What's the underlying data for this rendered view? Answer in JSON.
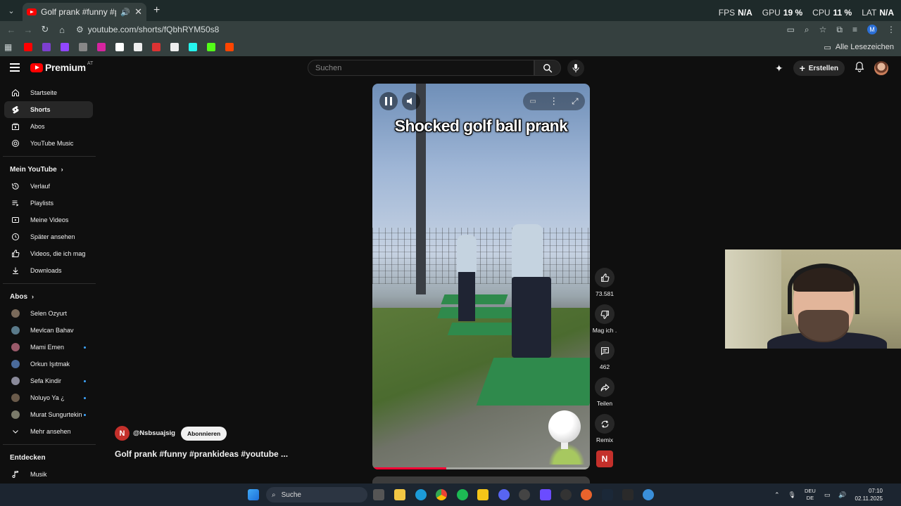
{
  "browser": {
    "tab_title": "Golf prank #funny #prankic",
    "url": "youtube.com/shorts/fQbhRYM50s8",
    "all_bookmarks": "Alle Lesezeichen",
    "profile_initial": "M"
  },
  "osd": {
    "fps_label": "FPS",
    "fps_value": "N/A",
    "gpu_label": "GPU",
    "gpu_value": "19 %",
    "cpu_label": "CPU",
    "cpu_value": "11 %",
    "lat_label": "LAT",
    "lat_value": "N/A"
  },
  "header": {
    "logo_text": "Premium",
    "region": "AT",
    "search_placeholder": "Suchen",
    "create_label": "Erstellen"
  },
  "sidebar": {
    "main": [
      {
        "label": "Startseite",
        "icon": "home-icon"
      },
      {
        "label": "Shorts",
        "icon": "shorts-icon"
      },
      {
        "label": "Abos",
        "icon": "subscriptions-icon"
      },
      {
        "label": "YouTube Music",
        "icon": "music-icon"
      }
    ],
    "you_title": "Mein YouTube",
    "you": [
      {
        "label": "Verlauf",
        "icon": "history-icon"
      },
      {
        "label": "Playlists",
        "icon": "playlists-icon"
      },
      {
        "label": "Meine Videos",
        "icon": "my-videos-icon"
      },
      {
        "label": "Später ansehen",
        "icon": "watch-later-icon"
      },
      {
        "label": "Videos, die ich mag",
        "icon": "liked-icon"
      },
      {
        "label": "Downloads",
        "icon": "download-icon"
      }
    ],
    "subs_title": "Abos",
    "subs": [
      {
        "label": "Selen Ozyurt",
        "color": "#7a6a5a",
        "dot": false
      },
      {
        "label": "Mevlcan Bahav",
        "color": "#5a7a8a",
        "dot": false
      },
      {
        "label": "Mami Emen",
        "color": "#9a5a6a",
        "dot": true
      },
      {
        "label": "Orkun Işıtmak",
        "color": "#4a6a9a",
        "dot": false
      },
      {
        "label": "Sefa Kindir",
        "color": "#8a8a9a",
        "dot": true
      },
      {
        "label": "Noluyo Ya ¿",
        "color": "#6a5a4a",
        "dot": true
      },
      {
        "label": "Murat Sungurtekin",
        "color": "#7a7a6a",
        "dot": true
      }
    ],
    "more_label": "Mehr ansehen",
    "explore_title": "Entdecken",
    "explore": [
      {
        "label": "Musik",
        "icon": "music-note-icon"
      }
    ]
  },
  "video": {
    "overlay_title": "Shocked golf ball prank",
    "progress": 0.34
  },
  "actions": {
    "like_count": "73.581",
    "dislike_label": "Mag ich .",
    "comment_count": "462",
    "share_label": "Teilen",
    "remix_label": "Remix",
    "channel_initial": "N"
  },
  "meta": {
    "channel_initial": "N",
    "handle": "@Nsbsuajsig",
    "subscribe_label": "Abonnieren",
    "caption": "Golf prank #funny #prankideas #youtube ..."
  },
  "taskbar": {
    "search_label": "Suche",
    "lang_top": "DEU",
    "lang_bottom": "DE",
    "time": "07:10",
    "date": "02.11.2025"
  }
}
